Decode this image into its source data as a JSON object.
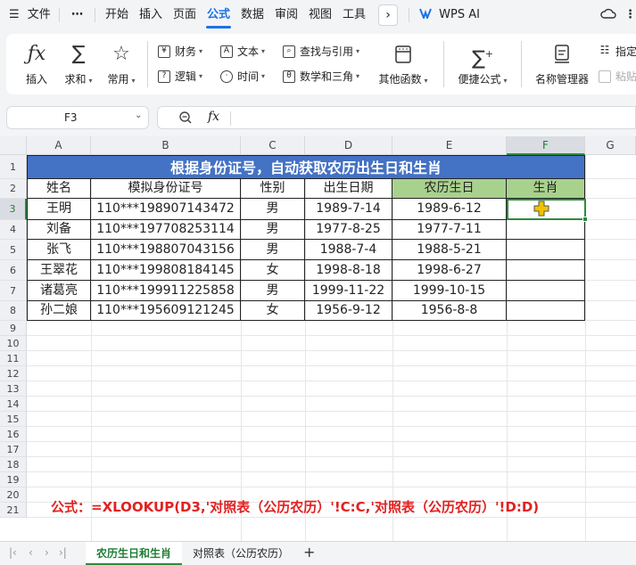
{
  "menubar": {
    "menu_icon": "hamburger-icon",
    "file": "文件",
    "more": "⋯",
    "tabs": [
      "开始",
      "插入",
      "页面",
      "公式",
      "数据",
      "审阅",
      "视图",
      "工具"
    ],
    "active_tab": "公式",
    "next": "›",
    "wps_ai": "WPS AI"
  },
  "ribbon": {
    "insert_icon": "fx-icon",
    "insert": "插入",
    "sum": "求和",
    "common": "常用",
    "finance": "财务",
    "text": "文本",
    "lookup": "查找与引用",
    "logic": "逻辑",
    "time": "时间",
    "math": "数学和三角",
    "other": "其他函数",
    "quick": "便捷公式",
    "name_mgr": "名称管理器",
    "specify": "指定",
    "paste": "粘贴"
  },
  "formula_bar": {
    "cell_ref": "F3",
    "fx": "fx",
    "formula": ""
  },
  "grid": {
    "columns": [
      "A",
      "B",
      "C",
      "D",
      "E",
      "F",
      "G"
    ],
    "rows": [
      "1",
      "2",
      "3",
      "4",
      "5",
      "6",
      "7",
      "8",
      "9",
      "10",
      "11",
      "12",
      "13",
      "14",
      "15",
      "16",
      "17",
      "18",
      "19",
      "20",
      "21"
    ],
    "selected_column": "F",
    "selected_row": "3",
    "title": "根据身份证号，自动获取农历出生日和生肖",
    "headers": [
      "姓名",
      "模拟身份证号",
      "性别",
      "出生日期",
      "农历生日",
      "生肖"
    ],
    "records": [
      [
        "王明",
        "110***198907143472",
        "男",
        "1989-7-14",
        "1989-6-12",
        ""
      ],
      [
        "刘备",
        "110***197708253114",
        "男",
        "1977-8-25",
        "1977-7-11",
        ""
      ],
      [
        "张飞",
        "110***198807043156",
        "男",
        "1988-7-4",
        "1988-5-21",
        ""
      ],
      [
        "王翠花",
        "110***199808184145",
        "女",
        "1998-8-18",
        "1998-6-27",
        ""
      ],
      [
        "诸葛亮",
        "110***199911225858",
        "男",
        "1999-11-22",
        "1999-10-15",
        ""
      ],
      [
        "孙二娘",
        "110***195609121245",
        "女",
        "1956-9-12",
        "1956-8-8",
        ""
      ]
    ],
    "formula_note": "公式：=XLOOKUP(D3,'对照表（公历农历）'!C:C,'对照表（公历农历）'!D:D)"
  },
  "sheets": {
    "tabs": [
      "农历生日和生肖",
      "对照表（公历农历）"
    ],
    "active": "农历生日和生肖",
    "add": "+"
  },
  "colors": {
    "accent": "#1a73e8",
    "title_bg": "#4472c4",
    "header_green": "#a9d18e",
    "selection": "#2e8b3c",
    "formula_note": "#e32020"
  }
}
